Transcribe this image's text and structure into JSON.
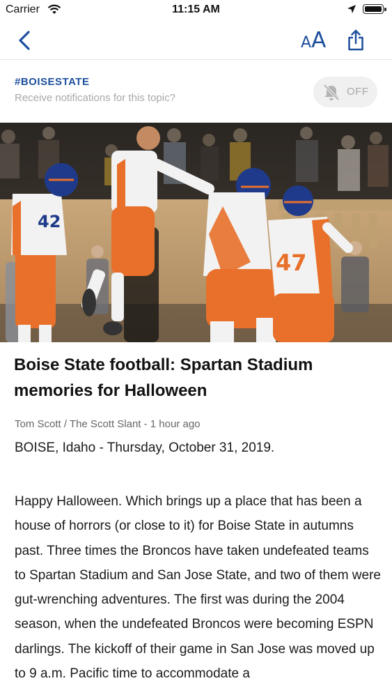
{
  "status_bar": {
    "carrier": "Carrier",
    "time": "11:15 AM"
  },
  "nav": {
    "back_icon": "chevron-left-icon",
    "text_size_label_small": "A",
    "text_size_label_large": "A",
    "share_icon": "share-icon",
    "accent_color": "#1d4f9c"
  },
  "topic": {
    "name": "#BOISESTATE",
    "subtitle": "Receive notifications for this topic?",
    "toggle_label": "OFF",
    "toggle_state": "off",
    "toggle_icon": "bell-slash-icon"
  },
  "hero_image": {
    "jersey_numbers": [
      "42",
      "47"
    ]
  },
  "article": {
    "headline": "Boise State football: Spartan Stadium memories for Halloween",
    "byline": "Tom Scott / The Scott Slant - 1 hour ago",
    "dateline": "BOISE, Idaho - Thursday, October 31, 2019.",
    "body": "Happy Halloween. Which brings up a place that has been a house of horrors (or close to it) for Boise State in autumns past. Three times the Broncos have taken undefeated teams to Spartan Stadium and San Jose State, and two of them were gut-wrenching adventures. The first was during the 2004 season, when the undefeated Broncos were becoming ESPN darlings. The kickoff of their game in San Jose was moved up to 9 a.m. Pacific time to accommodate a"
  }
}
